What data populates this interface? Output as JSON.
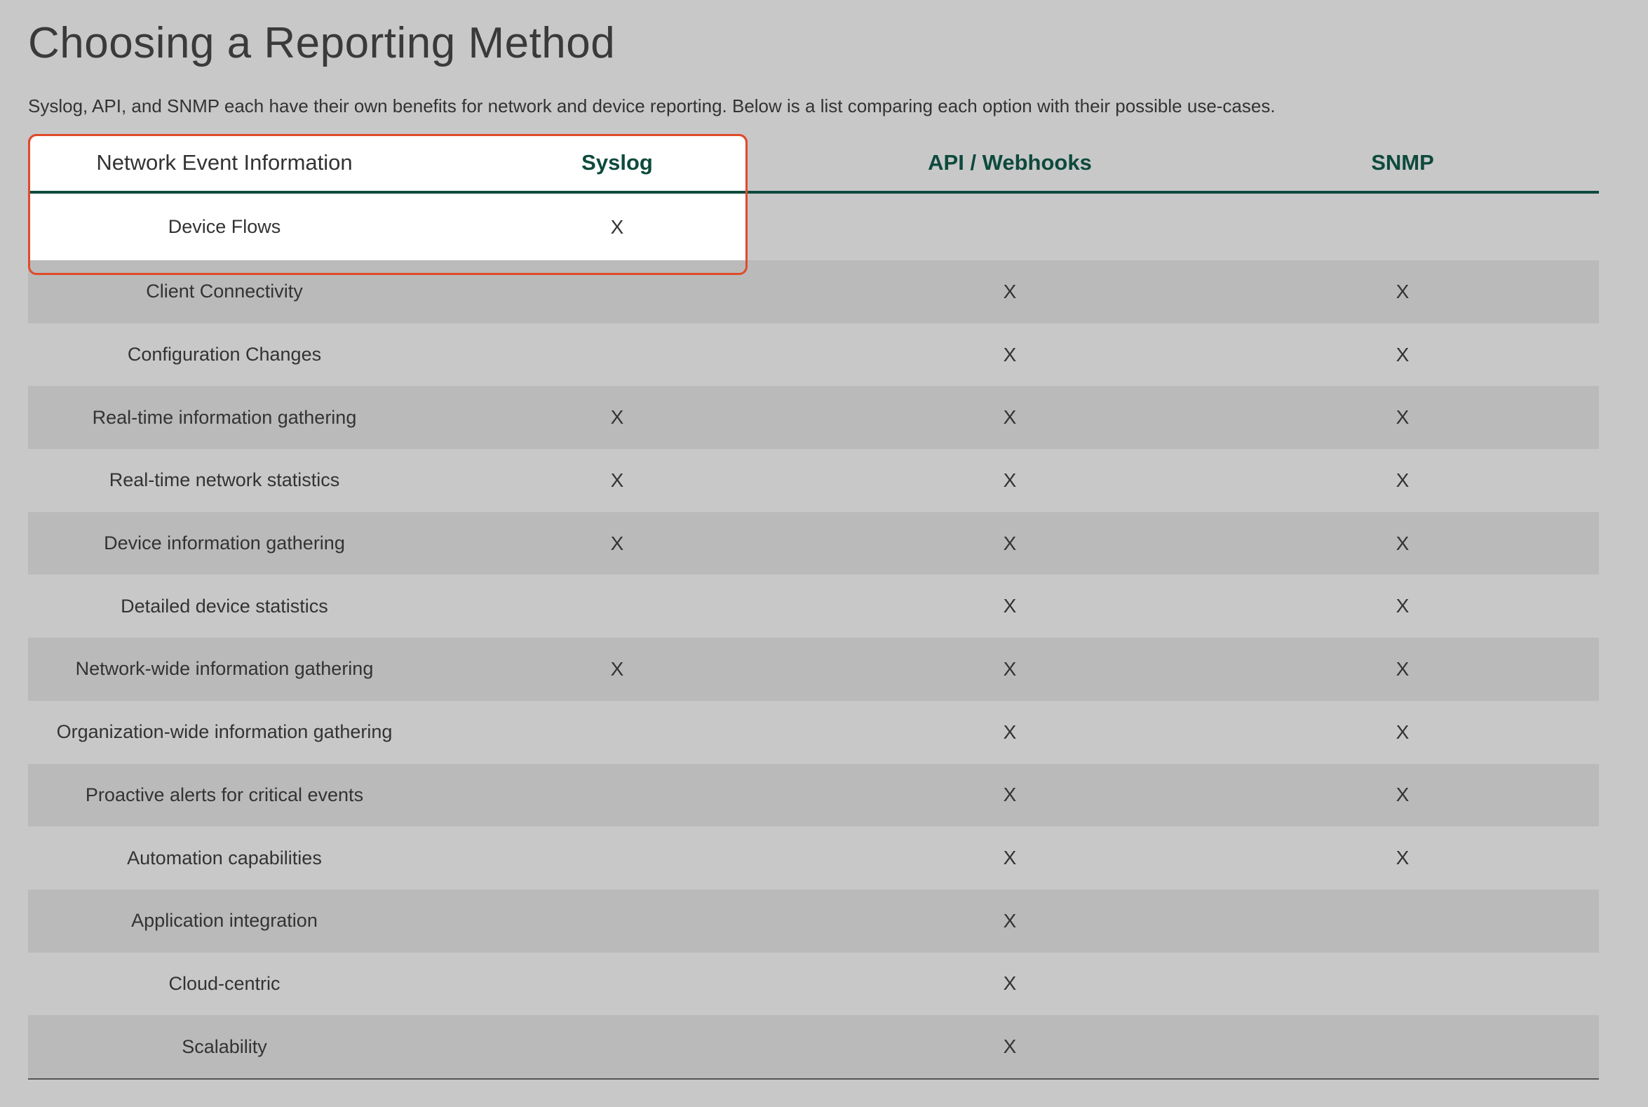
{
  "page": {
    "title": "Choosing a Reporting Method",
    "intro": "Syslog, API, and SNMP each have their own benefits for network and device reporting.  Below is a list comparing each option with their possible use-cases."
  },
  "table": {
    "headers": [
      "Network Event Information",
      "Syslog",
      "API / Webhooks",
      "SNMP"
    ],
    "rows": [
      {
        "feature": "Device Flows",
        "syslog": "X",
        "api": "",
        "snmp": ""
      },
      {
        "feature": "Client Connectivity",
        "syslog": "",
        "api": "X",
        "snmp": "X"
      },
      {
        "feature": "Configuration Changes",
        "syslog": "",
        "api": "X",
        "snmp": "X"
      },
      {
        "feature": "Real-time information gathering",
        "syslog": "X",
        "api": "X",
        "snmp": "X"
      },
      {
        "feature": "Real-time network statistics",
        "syslog": "X",
        "api": "X",
        "snmp": "X"
      },
      {
        "feature": "Device information gathering",
        "syslog": "X",
        "api": "X",
        "snmp": "X"
      },
      {
        "feature": "Detailed device statistics",
        "syslog": "",
        "api": "X",
        "snmp": "X"
      },
      {
        "feature": "Network-wide information gathering",
        "syslog": "X",
        "api": "X",
        "snmp": "X"
      },
      {
        "feature": "Organization-wide information gathering",
        "syslog": "",
        "api": "X",
        "snmp": "X"
      },
      {
        "feature": "Proactive alerts for critical events",
        "syslog": "",
        "api": "X",
        "snmp": "X"
      },
      {
        "feature": "Automation capabilities",
        "syslog": "",
        "api": "X",
        "snmp": "X"
      },
      {
        "feature": "Application integration",
        "syslog": "",
        "api": "X",
        "snmp": ""
      },
      {
        "feature": "Cloud-centric",
        "syslog": "",
        "api": "X",
        "snmp": ""
      },
      {
        "feature": "Scalability",
        "syslog": "",
        "api": "X",
        "snmp": ""
      }
    ]
  },
  "colors": {
    "background": "#c8c8c8",
    "shaded_row": "#bababa",
    "header_accent": "#0d4a3c",
    "highlight_border": "#e04a2a",
    "highlight_fill": "#ffffff"
  }
}
